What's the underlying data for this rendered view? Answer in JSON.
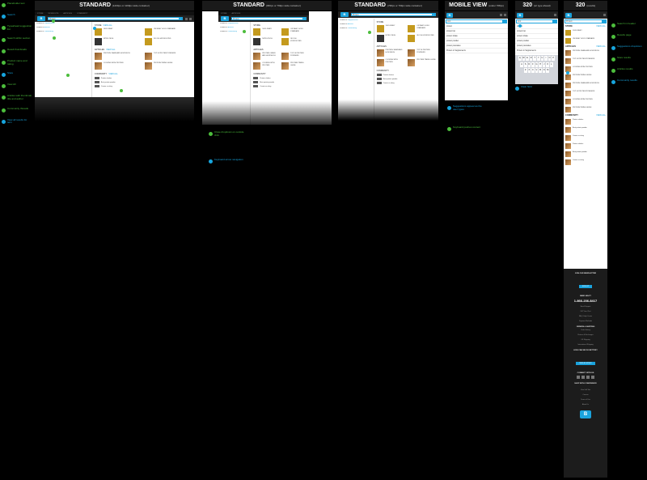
{
  "columns": [
    {
      "title": "STANDARD",
      "subtitle": "(1200px or 1199px wide container)"
    },
    {
      "title": "STANDARD",
      "subtitle": "(960px or 799px wide container)"
    },
    {
      "title": "STANDARD",
      "subtitle": "(768px or 799px wide container)"
    },
    {
      "title": "MOBILE VIEW",
      "subtitle": "(under 768px)"
    },
    {
      "title": "320",
      "subtitle": "(w/ type ahead)"
    },
    {
      "title": "320",
      "subtitle": "(results)"
    }
  ],
  "search": {
    "query": "Protein",
    "mobile_query": "prot"
  },
  "suggestions": [
    {
      "prefix": "Protein in ",
      "term": "Supplements"
    },
    {
      "prefix": "Protein in ",
      "term": "Articles"
    },
    {
      "prefix": "Protein in ",
      "term": "Community"
    }
  ],
  "results": {
    "store_title": "STORE",
    "articles_title": "ARTICLES",
    "community_title": "COMMUNITY",
    "view_all": "VIEW ALL",
    "products": [
      "100% WHEY",
      "ON WHEY GOLD STANDARD",
      "NITRO-TECH",
      "ISO 100 HYDROLYZED"
    ],
    "articles": [
      "PROTEIN: WHEN AND HOW MUCH",
      "TOP 10 PROTEIN POWDERS",
      "COOKING WITH PROTEIN",
      "PROTEIN TIMING GUIDE"
    ],
    "community": [
      "Protein shakes",
      "Best protein powder",
      "Casein vs whey"
    ]
  },
  "mobile_suggestions": [
    "protein",
    "protein bar",
    "protein shake",
    "protein powder",
    "protein pancakes",
    "Protein in Supplements"
  ],
  "keyboard": [
    [
      "Q",
      "W",
      "E",
      "R",
      "T",
      "Y",
      "U",
      "I",
      "O",
      "P"
    ],
    [
      "A",
      "S",
      "D",
      "F",
      "G",
      "H",
      "J",
      "K",
      "L"
    ],
    [
      "Z",
      "X",
      "C",
      "V",
      "B",
      "N",
      "M"
    ]
  ],
  "footer": {
    "newsletter": "JOIN OUR NEWSLETTER",
    "need_help": "NEED HELP?",
    "phone": "1-866-236-8417",
    "help_links": [
      "Email Support",
      "24/7 Live Chat",
      "FAQ / Help Center",
      "Payment Methods"
    ],
    "orders": "ORDERS & SHIPPING",
    "order_links": [
      "Order History",
      "Returns & Exchanges",
      "US Shipping",
      "International Shipping"
    ],
    "feedback": "HOW CAN WE DO BETTER?",
    "feedback_btn": "TAKE A SURVEY",
    "connect": "CONNECT WITH US",
    "confidence": "SHOP WITH CONFIDENCE",
    "links": [
      "View Full Site",
      "Careers",
      "Terms of Use",
      "About Us"
    ]
  },
  "left_notes": [
    {
      "color": "green",
      "text": "Placeholder text"
    },
    {
      "color": "blue",
      "text": "Search"
    },
    {
      "color": "green",
      "text": "Typeahead suggestion list"
    },
    {
      "color": "green",
      "text": "Search within section"
    },
    {
      "color": "green",
      "text": "Result thumbnails"
    },
    {
      "color": "green",
      "text": "Product name and rating"
    },
    {
      "color": "blue",
      "text": "Store"
    },
    {
      "color": "green",
      "text": "View All"
    },
    {
      "color": "green",
      "text": "Articles with thumbnail, title and author"
    },
    {
      "color": "green",
      "text": "Community threads"
    },
    {
      "color": "blue",
      "text": "View all results for term"
    },
    {
      "color": "green",
      "text": "Close dropdown on outside click"
    },
    {
      "color": "blue",
      "text": "Keyboard arrow navigation"
    },
    {
      "color": "green",
      "text": "Enter submits search"
    },
    {
      "color": "blue",
      "text": "Clear field"
    }
  ],
  "right_notes": [
    {
      "color": "green",
      "text": "Search in header"
    },
    {
      "color": "green",
      "text": "Results page"
    },
    {
      "color": "blue",
      "text": "Suggestions dropdown"
    },
    {
      "color": "green",
      "text": "Store results"
    },
    {
      "color": "green",
      "text": "Articles results"
    },
    {
      "color": "blue",
      "text": "Community results"
    }
  ],
  "mobile_note": "Suggestions appear as the user types",
  "mobile_note2": "Keyboard pushes content"
}
